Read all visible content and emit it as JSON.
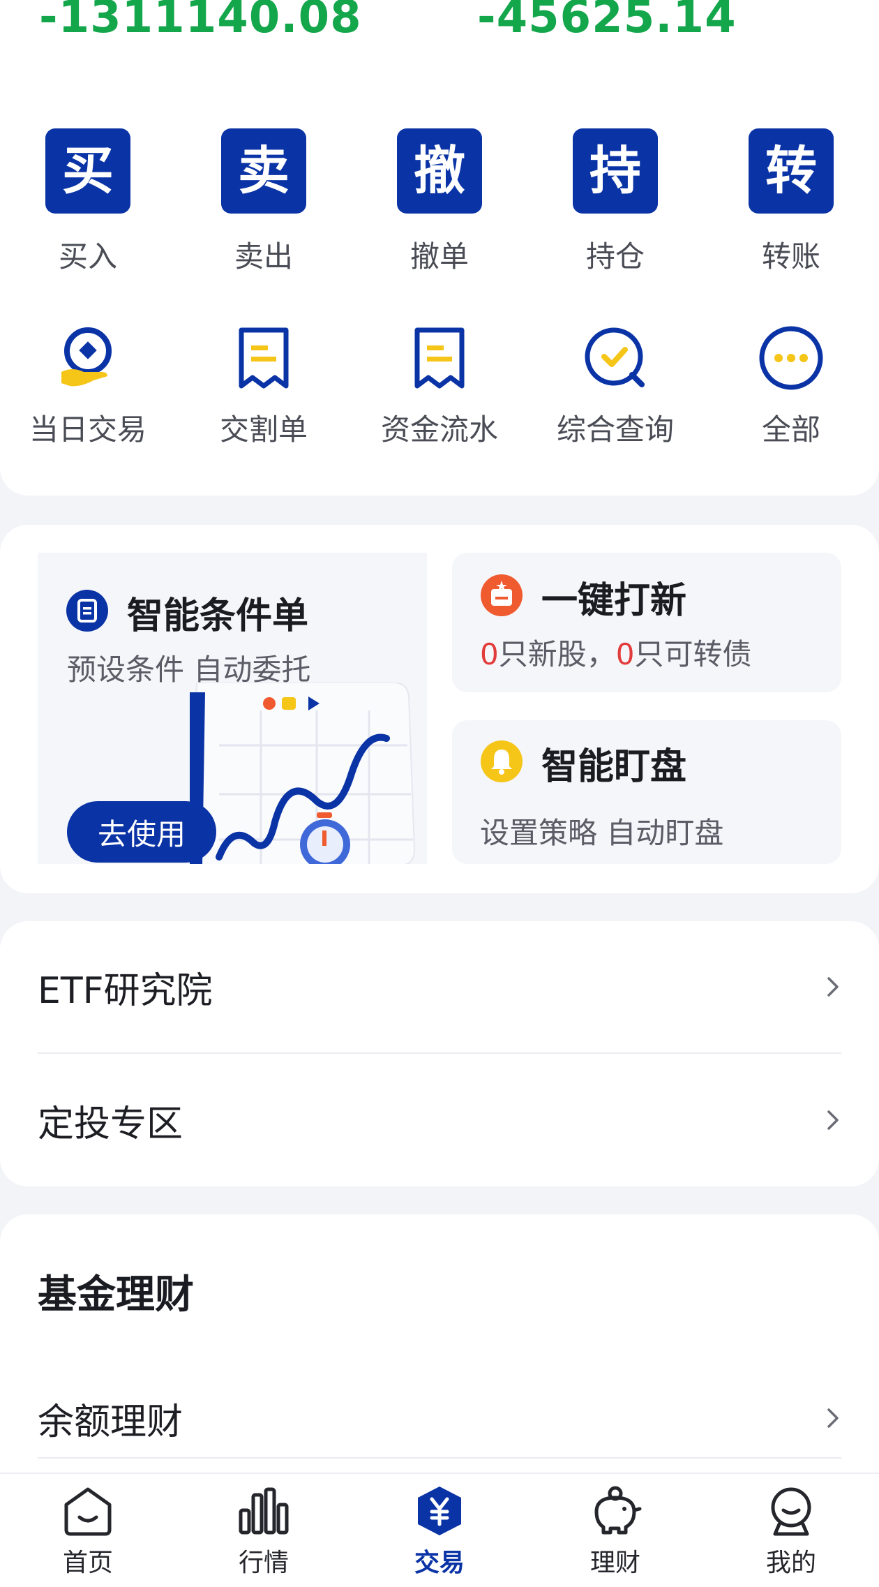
{
  "summary": {
    "value_left": "-1311140.08",
    "value_right": "-45625.14"
  },
  "primary_actions": [
    {
      "glyph": "买",
      "label": "买入",
      "icon": "buy-icon"
    },
    {
      "glyph": "卖",
      "label": "卖出",
      "icon": "sell-icon"
    },
    {
      "glyph": "撤",
      "label": "撤单",
      "icon": "cancel-icon"
    },
    {
      "glyph": "持",
      "label": "持仓",
      "icon": "position-icon"
    },
    {
      "glyph": "转",
      "label": "转账",
      "icon": "transfer-icon"
    }
  ],
  "secondary_actions": [
    {
      "label": "当日交易",
      "icon": "coin-hand-icon"
    },
    {
      "label": "交割单",
      "icon": "receipt-icon"
    },
    {
      "label": "资金流水",
      "icon": "receipt-icon"
    },
    {
      "label": "综合查询",
      "icon": "check-search-icon"
    },
    {
      "label": "全部",
      "icon": "more-icon"
    }
  ],
  "tools": {
    "condition": {
      "title": "智能条件单",
      "subtitle": "预设条件 自动委托",
      "button": "去使用"
    },
    "ipo": {
      "title": "一键打新",
      "count_stocks": "0",
      "stocks_text": "只新股，",
      "count_bonds": "0",
      "bonds_text": "只可转债"
    },
    "watch": {
      "title": "智能盯盘",
      "subtitle": "设置策略 自动盯盘"
    }
  },
  "links": [
    {
      "label": "ETF研究院"
    },
    {
      "label": "定投专区"
    }
  ],
  "fund": {
    "title": "基金理财",
    "items": [
      {
        "label": "余额理财"
      }
    ]
  },
  "tabbar": [
    {
      "label": "首页",
      "icon": "home-icon"
    },
    {
      "label": "行情",
      "icon": "market-chart-icon"
    },
    {
      "label": "交易",
      "icon": "trade-yuan-icon",
      "active": true
    },
    {
      "label": "理财",
      "icon": "piggy-bank-icon"
    },
    {
      "label": "我的",
      "icon": "profile-icon"
    }
  ],
  "colors": {
    "brand": "#0a33a6",
    "down_green": "#13a64b",
    "accent_red": "#e23b3b",
    "accent_yellow": "#f5c518",
    "accent_orange": "#ef5a2f"
  }
}
